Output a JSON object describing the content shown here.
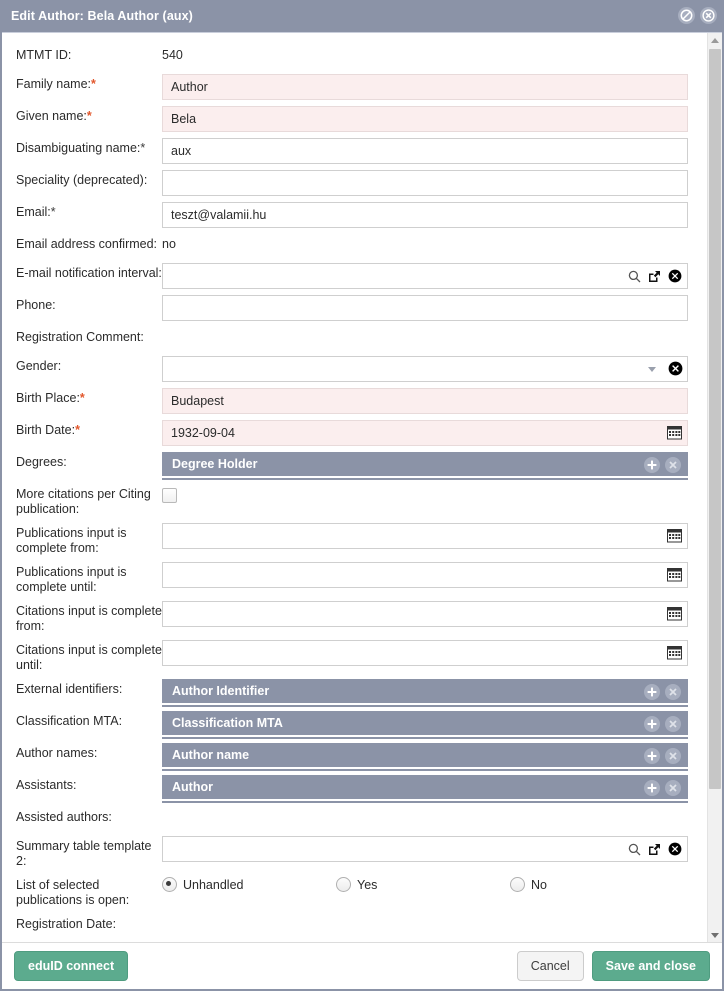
{
  "window": {
    "title": "Edit Author: Bela Author (aux)",
    "title_icons": [
      {
        "name": "disable-icon",
        "glyph": "slash-circle"
      },
      {
        "name": "close-icon",
        "glyph": "x-circle"
      }
    ],
    "titlebar_color": "#8b93a7",
    "accent_green": "#5cab8e",
    "required_field_bg": "#fbeeee",
    "required_marker_color": "#e2572c"
  },
  "form": {
    "rows": [
      {
        "label": "MTMT ID:",
        "type": "static",
        "value": "540"
      },
      {
        "label": "Family name:",
        "required": true,
        "type": "input",
        "value": "Author",
        "highlight": true
      },
      {
        "label": "Given name:",
        "required": true,
        "type": "input",
        "value": "Bela",
        "highlight": true
      },
      {
        "label": "Disambiguating name:",
        "required": true,
        "required_dark": true,
        "type": "input",
        "value": "aux",
        "highlight": false
      },
      {
        "label": "Speciality (deprecated):",
        "type": "input",
        "value": "",
        "highlight": false
      },
      {
        "label": "Email:",
        "required": true,
        "required_dark": true,
        "type": "input",
        "value": "teszt@valamii.hu",
        "highlight": false
      },
      {
        "label": "Email address confirmed:",
        "type": "static",
        "value": "no"
      },
      {
        "label": "E-mail notification interval:",
        "type": "lookup",
        "value": ""
      },
      {
        "label": "Phone:",
        "type": "input",
        "value": "",
        "highlight": false
      },
      {
        "label": "Registration Comment:",
        "type": "empty",
        "value": ""
      },
      {
        "label": "Gender:",
        "type": "select",
        "value": ""
      },
      {
        "label": "Birth Place:",
        "required": true,
        "type": "input",
        "value": "Budapest",
        "highlight": true
      },
      {
        "label": "Birth Date:",
        "required": true,
        "type": "date",
        "value": "1932-09-04",
        "highlight": true
      },
      {
        "label": "Degrees:",
        "type": "section",
        "section_title": "Degree Holder"
      },
      {
        "label": "More citations per Citing publication:",
        "type": "checkbox",
        "checked": false
      },
      {
        "label": "Publications input is complete from:",
        "type": "date",
        "value": "",
        "highlight": false
      },
      {
        "label": "Publications input is complete until:",
        "type": "date",
        "value": "",
        "highlight": false
      },
      {
        "label": "Citations input is complete from:",
        "type": "date",
        "value": "",
        "highlight": false
      },
      {
        "label": "Citations input is complete until:",
        "type": "date",
        "value": "",
        "highlight": false
      },
      {
        "label": "External identifiers:",
        "type": "section",
        "section_title": "Author Identifier"
      },
      {
        "label": "Classification MTA:",
        "type": "section",
        "section_title": "Classification MTA"
      },
      {
        "label": "Author names:",
        "type": "section",
        "section_title": "Author name"
      },
      {
        "label": "Assistants:",
        "type": "section",
        "section_title": "Author"
      },
      {
        "label": "Assisted authors:",
        "type": "empty",
        "value": ""
      },
      {
        "label": "Summary table template 2:",
        "type": "lookup",
        "value": ""
      },
      {
        "label": "List of selected publications is open:",
        "type": "radio"
      },
      {
        "label": "Registration Date:",
        "type": "empty",
        "value": ""
      }
    ],
    "radio_options": [
      {
        "label": "Unhandled",
        "checked": true
      },
      {
        "label": "Yes",
        "checked": false
      },
      {
        "label": "No",
        "checked": false
      }
    ],
    "field_icon_names": {
      "lookup_search": "search-icon",
      "lookup_popup": "external-link-icon",
      "lookup_clear": "clear-circle-icon",
      "date_calendar": "calendar-icon",
      "select_caret": "chevron-down-icon",
      "section_add": "plus-circle-icon",
      "section_remove": "remove-circle-icon"
    }
  },
  "footer": {
    "eduid_label": "eduID connect",
    "cancel_label": "Cancel",
    "save_label": "Save and close"
  },
  "scrollbar": {
    "up_arrow": "scroll-up-arrow",
    "down_arrow": "scroll-down-arrow"
  }
}
